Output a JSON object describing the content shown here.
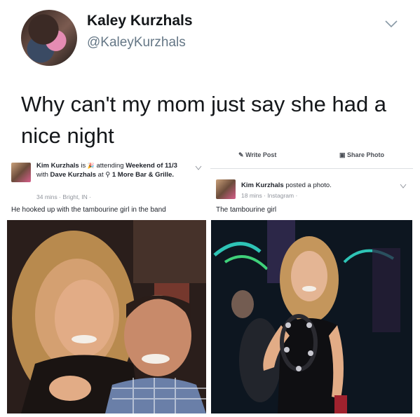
{
  "tweet": {
    "display_name": "Kaley Kurzhals",
    "handle": "@KaleyKurzhals",
    "text": "Why can't my mom just say she had a nice night"
  },
  "left_post": {
    "author": "Kim Kurzhals",
    "is_word": "is",
    "attending": "attending",
    "event": "Weekend of 11/3",
    "with_word": "with",
    "companion": "Dave Kurzhals",
    "at_word": "at",
    "place": "1 More Bar & Grille.",
    "meta": "34 mins · Bright, IN ·",
    "caption": "He hooked up with the tambourine girl in the band"
  },
  "right_post": {
    "write_post": "Write Post",
    "share_photo": "Share Photo",
    "author": "Kim Kurzhals",
    "action": "posted a photo.",
    "meta": "18 mins · Instagram ·",
    "caption": "The tambourine girl"
  },
  "colors": {
    "text": "#14171a",
    "secondary": "#657786",
    "fb_meta": "#90949c"
  }
}
